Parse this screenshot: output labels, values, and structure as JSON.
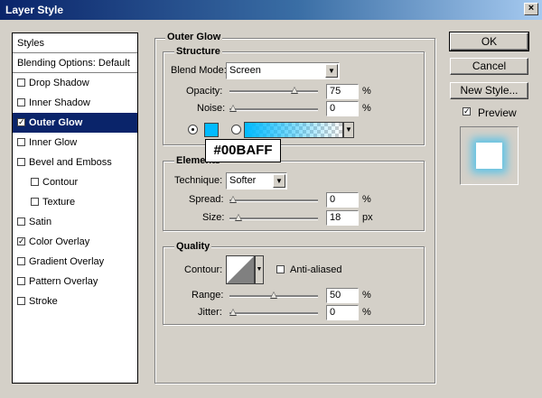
{
  "window": {
    "title": "Layer Style",
    "close_glyph": "×"
  },
  "styles_panel": {
    "header": "Styles",
    "items": [
      {
        "label": "Blending Options: Default",
        "checkbox": false,
        "checked": false,
        "selected": false,
        "sub": false
      },
      {
        "label": "Drop Shadow",
        "checkbox": true,
        "checked": false,
        "selected": false,
        "sub": false
      },
      {
        "label": "Inner Shadow",
        "checkbox": true,
        "checked": false,
        "selected": false,
        "sub": false
      },
      {
        "label": "Outer Glow",
        "checkbox": true,
        "checked": true,
        "selected": true,
        "sub": false
      },
      {
        "label": "Inner Glow",
        "checkbox": true,
        "checked": false,
        "selected": false,
        "sub": false
      },
      {
        "label": "Bevel and Emboss",
        "checkbox": true,
        "checked": false,
        "selected": false,
        "sub": false
      },
      {
        "label": "Contour",
        "checkbox": true,
        "checked": false,
        "selected": false,
        "sub": true
      },
      {
        "label": "Texture",
        "checkbox": true,
        "checked": false,
        "selected": false,
        "sub": true
      },
      {
        "label": "Satin",
        "checkbox": true,
        "checked": false,
        "selected": false,
        "sub": false
      },
      {
        "label": "Color Overlay",
        "checkbox": true,
        "checked": true,
        "selected": false,
        "sub": false
      },
      {
        "label": "Gradient Overlay",
        "checkbox": true,
        "checked": false,
        "selected": false,
        "sub": false
      },
      {
        "label": "Pattern Overlay",
        "checkbox": true,
        "checked": false,
        "selected": false,
        "sub": false
      },
      {
        "label": "Stroke",
        "checkbox": true,
        "checked": false,
        "selected": false,
        "sub": false
      }
    ]
  },
  "outer_glow": {
    "title": "Outer Glow",
    "structure": {
      "title": "Structure",
      "blend_mode_label": "Blend Mode:",
      "blend_mode_value": "Screen",
      "opacity_label": "Opacity:",
      "opacity_value": "75",
      "opacity_level": 0.75,
      "noise_label": "Noise:",
      "noise_value": "0",
      "noise_level": 0,
      "percent": "%",
      "glow_color": "#00BAFF"
    },
    "tooltip": "#00BAFF",
    "elements": {
      "title": "Elements",
      "technique_label": "Technique:",
      "technique_value": "Softer",
      "spread_label": "Spread:",
      "spread_value": "0",
      "spread_level": 0,
      "size_label": "Size:",
      "size_value": "18",
      "size_level": 0.072,
      "percent": "%",
      "px": "px"
    },
    "quality": {
      "title": "Quality",
      "contour_label": "Contour:",
      "anti_aliased_label": "Anti-aliased",
      "anti_aliased_checked": false,
      "range_label": "Range:",
      "range_value": "50",
      "range_level": 0.5,
      "jitter_label": "Jitter:",
      "jitter_value": "0",
      "jitter_level": 0,
      "percent": "%"
    }
  },
  "buttons": {
    "ok": "OK",
    "cancel": "Cancel",
    "new_style": "New Style..."
  },
  "preview": {
    "label": "Preview",
    "checked": true
  },
  "colors": {
    "titlebar": "#0a246a",
    "selected": "#0a246a",
    "glow": "#00BAFF",
    "dialog": "#d4d0c8"
  }
}
